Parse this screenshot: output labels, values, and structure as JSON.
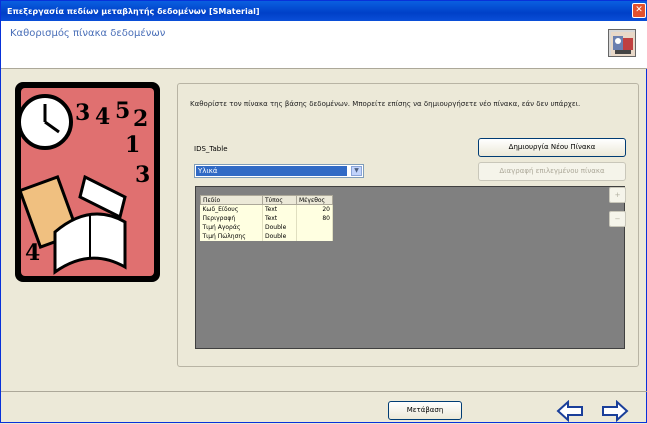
{
  "window": {
    "title": "Επεξεργασία πεδίων μεταβλητής δεδομένων [SMaterial]",
    "close_glyph": "✕"
  },
  "header": {
    "title": "Καθορισμός πίνακα δεδομένων",
    "logo_icon": "wizard-logo-icon"
  },
  "main": {
    "description": "Καθορίστε τον πίνακα της βάσης δεδομένων. Μπορείτε επίσης να δημιουργήσετε νέο πίνακα, εάν δεν υπάρχει.",
    "table_label": "IDS_Table",
    "table_select_value": "Υλικά",
    "create_table_button": "Δημιουργία Νέου Πίνακα",
    "second_button": "Διαγραφή επιλεγμένου πίνακα",
    "fields_table": {
      "columns": [
        "Πεδίο",
        "Τύπος",
        "Μέγεθος"
      ],
      "rows": [
        [
          "Κωδ_Είδους",
          "Text",
          "20"
        ],
        [
          "Περιγραφή",
          "Text",
          "80"
        ],
        [
          "Τιμή Αγοράς",
          "Double",
          ""
        ],
        [
          "Τιμή Πώλησης",
          "Double",
          ""
        ]
      ]
    },
    "side_buttons": [
      "+",
      "−"
    ]
  },
  "footer": {
    "next_button": "Μετάβαση",
    "back_icon": "back-arrow-icon",
    "forward_icon": "forward-arrow-icon"
  },
  "colors": {
    "titlebar": "#0a4fd8",
    "header_title": "#4a6fb8",
    "selection": "#316ac5",
    "grid_background": "#808080"
  }
}
